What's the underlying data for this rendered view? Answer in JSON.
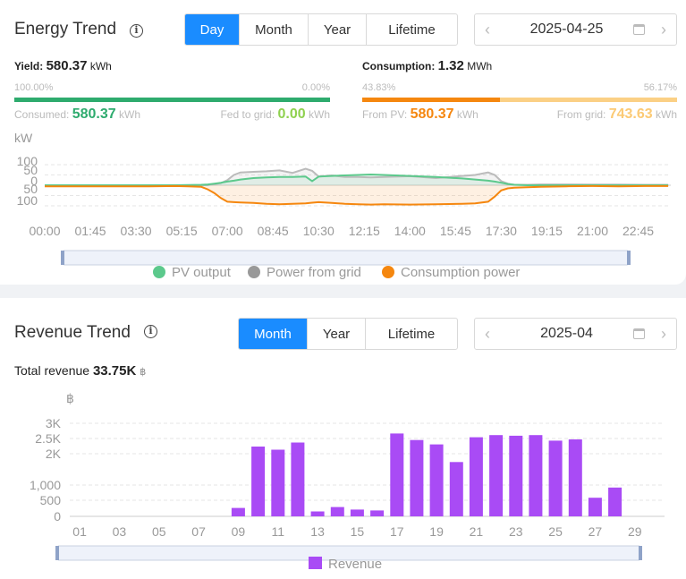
{
  "energy": {
    "title": "Energy Trend",
    "tabs": [
      {
        "label": "Day",
        "active": true
      },
      {
        "label": "Month",
        "active": false
      },
      {
        "label": "Year",
        "active": false
      },
      {
        "label": "Lifetime",
        "active": false
      }
    ],
    "date": "2025-04-25",
    "yield": {
      "label": "Yield:",
      "value": "580.37",
      "unit": "kWh"
    },
    "yield_split": {
      "left_pct": "100.00%",
      "right_pct": "0.00%",
      "consumed_label": "Consumed:",
      "consumed_value": "580.37",
      "consumed_unit": "kWh",
      "fed_label": "Fed to grid:",
      "fed_value": "0.00",
      "fed_unit": "kWh"
    },
    "consumption": {
      "label": "Consumption:",
      "value": "1.32",
      "unit": "MWh"
    },
    "consumption_split": {
      "left_pct": "43.83%",
      "right_pct": "56.17%",
      "pv_label": "From PV:",
      "pv_value": "580.37",
      "pv_unit": "kWh",
      "grid_label": "From grid:",
      "grid_value": "743.63",
      "grid_unit": "kWh"
    },
    "colors": {
      "pv": "#5cc98c",
      "grid": "#bbbbbb",
      "consumption": "#f5870f",
      "yield_bar": "#2eab6e",
      "pv_bar": "#f5870f",
      "grid_bar": "#fbd085",
      "fed_text": "#8fd14f",
      "grid_text": "#fbca75"
    }
  },
  "revenue": {
    "title": "Revenue Trend",
    "tabs": [
      {
        "label": "Month",
        "active": true
      },
      {
        "label": "Year",
        "active": false
      },
      {
        "label": "Lifetime",
        "active": false
      }
    ],
    "date": "2025-04",
    "total_label": "Total revenue",
    "total_value": "33.75K",
    "total_unit": "฿",
    "color": "#a94bf5"
  },
  "chart_data": [
    {
      "type": "line",
      "ylabel": "kW",
      "ylim": [
        -100,
        100
      ],
      "yticks": [
        "100",
        "50",
        "0",
        "50",
        "100"
      ],
      "xticks": [
        "00:00",
        "01:45",
        "03:30",
        "05:15",
        "07:00",
        "08:45",
        "10:30",
        "12:15",
        "14:00",
        "15:45",
        "17:30",
        "19:15",
        "21:00",
        "22:45"
      ],
      "x_hours": [
        0,
        1,
        2,
        3,
        4,
        5,
        5.5,
        6,
        6.25,
        6.5,
        6.75,
        7,
        7.25,
        7.5,
        8,
        8.5,
        9,
        9.5,
        10,
        10.25,
        10.5,
        11,
        11.5,
        12,
        12.5,
        13,
        14,
        15,
        16,
        16.5,
        17,
        17.25,
        17.5,
        17.75,
        18,
        18.5,
        19,
        20,
        21,
        22,
        23,
        23.9
      ],
      "series": [
        {
          "name": "PV output",
          "values": [
            0,
            0,
            0,
            0,
            0,
            0,
            1,
            2,
            4,
            8,
            12,
            18,
            22,
            28,
            35,
            38,
            40,
            40,
            42,
            20,
            42,
            45,
            48,
            50,
            52,
            50,
            45,
            40,
            33,
            28,
            22,
            18,
            12,
            6,
            2,
            0,
            0,
            0,
            0,
            0,
            0,
            0
          ]
        },
        {
          "name": "Power from grid",
          "values": [
            0,
            0,
            0,
            0,
            0,
            0,
            0,
            0,
            0,
            5,
            10,
            25,
            50,
            62,
            65,
            68,
            72,
            60,
            80,
            70,
            42,
            48,
            40,
            40,
            38,
            40,
            44,
            35,
            45,
            50,
            62,
            50,
            20,
            8,
            2,
            2,
            4,
            4,
            3,
            3,
            2,
            2
          ]
        },
        {
          "name": "Consumption power",
          "values": [
            -5,
            -5,
            -5,
            -5,
            -5,
            -4,
            -5,
            -8,
            -20,
            -38,
            -62,
            -80,
            -82,
            -84,
            -86,
            -90,
            -92,
            -90,
            -88,
            -85,
            -82,
            -86,
            -90,
            -92,
            -94,
            -92,
            -94,
            -92,
            -90,
            -88,
            -80,
            -55,
            -25,
            -15,
            -12,
            -10,
            -8,
            -5,
            -4,
            -5,
            -4,
            -4
          ]
        }
      ],
      "legend_position": "bottom"
    },
    {
      "type": "bar",
      "ylabel": "฿",
      "ylim": [
        0,
        3000
      ],
      "yticks": [
        "3K",
        "2.5K",
        "2K",
        "1,000",
        "500",
        "0"
      ],
      "xticks": [
        "01",
        "03",
        "05",
        "07",
        "09",
        "11",
        "13",
        "15",
        "17",
        "19",
        "21",
        "23",
        "25",
        "27",
        "29"
      ],
      "categories": [
        "01",
        "02",
        "03",
        "04",
        "05",
        "06",
        "07",
        "08",
        "09",
        "10",
        "11",
        "12",
        "13",
        "14",
        "15",
        "16",
        "17",
        "18",
        "19",
        "20",
        "21",
        "22",
        "23",
        "24",
        "25",
        "26",
        "27",
        "28",
        "29",
        "30"
      ],
      "series": [
        {
          "name": "Revenue",
          "values": [
            0,
            0,
            0,
            0,
            0,
            0,
            0,
            0,
            270,
            2250,
            2150,
            2380,
            160,
            300,
            220,
            190,
            2670,
            2460,
            2320,
            1750,
            2550,
            2620,
            2600,
            2620,
            2440,
            2480,
            600,
            930,
            0,
            0
          ]
        }
      ],
      "legend_position": "bottom"
    }
  ]
}
